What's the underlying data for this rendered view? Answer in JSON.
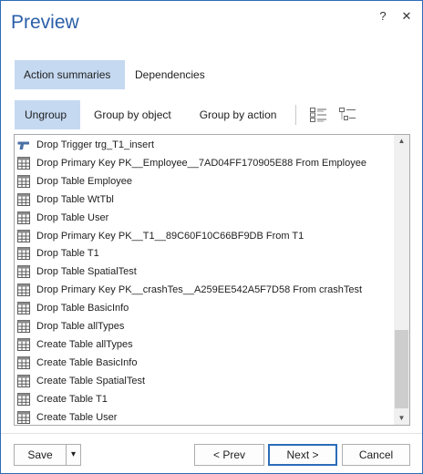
{
  "window": {
    "title": "Preview",
    "help_label": "?",
    "close_label": "✕"
  },
  "tabs": [
    {
      "label": "Action summaries",
      "active": true
    },
    {
      "label": "Dependencies",
      "active": false
    }
  ],
  "group_buttons": [
    {
      "label": "Ungroup",
      "active": true
    },
    {
      "label": "Group by object",
      "active": false
    },
    {
      "label": "Group by action",
      "active": false
    }
  ],
  "view_icons": [
    "detail-view-icon",
    "tree-view-icon"
  ],
  "actions": [
    {
      "icon": "trigger-icon",
      "text": "Drop Trigger trg_T1_insert"
    },
    {
      "icon": "table-icon",
      "text": "Drop Primary Key PK__Employee__7AD04FF170905E88 From Employee"
    },
    {
      "icon": "table-icon",
      "text": "Drop Table Employee"
    },
    {
      "icon": "table-icon",
      "text": "Drop Table WtTbl"
    },
    {
      "icon": "table-icon",
      "text": "Drop Table User"
    },
    {
      "icon": "table-icon",
      "text": "Drop Primary Key PK__T1__89C60F10C66BF9DB From T1"
    },
    {
      "icon": "table-icon",
      "text": "Drop Table T1"
    },
    {
      "icon": "table-icon",
      "text": "Drop Table SpatialTest"
    },
    {
      "icon": "table-icon",
      "text": "Drop Primary Key PK__crashTes__A259EE542A5F7D58 From crashTest"
    },
    {
      "icon": "table-icon",
      "text": "Drop Table BasicInfo"
    },
    {
      "icon": "table-icon",
      "text": "Drop Table allTypes"
    },
    {
      "icon": "table-icon",
      "text": "Create Table allTypes"
    },
    {
      "icon": "table-icon",
      "text": "Create Table BasicInfo"
    },
    {
      "icon": "table-icon",
      "text": "Create Table SpatialTest"
    },
    {
      "icon": "table-icon",
      "text": "Create Table T1"
    },
    {
      "icon": "table-icon",
      "text": "Create Table User"
    }
  ],
  "footer": {
    "save_label": "Save",
    "save_dropdown_label": "▾",
    "prev_label": "< Prev",
    "next_label": "Next >",
    "cancel_label": "Cancel"
  },
  "colors": {
    "accent": "#2b5fa8",
    "selected_tab": "#c5d9f1",
    "trigger": "#4a6fa5",
    "table": "#5a5a5a"
  }
}
